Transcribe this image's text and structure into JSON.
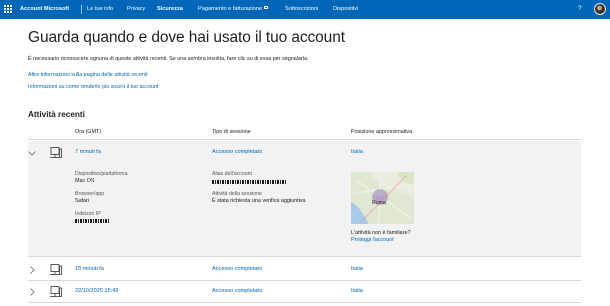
{
  "topbar": {
    "brand": "Account Microsoft",
    "nav": [
      "Le tue info",
      "Privacy",
      "Sicurezza",
      "Pagamento e fatturazione",
      "Sottoscrizioni",
      "Dispositivi"
    ],
    "active": "Sicurezza",
    "help": "?",
    "background": "#0067b8"
  },
  "page": {
    "title": "Guarda quando e dove hai usato il tuo account",
    "intro": "È necessario riconoscere ognuna di queste attività recenti. Se una sembra insolita, fare clic su di essa per segnalarla.",
    "links": [
      "Altre informazioni sulla pagina delle attività recenti",
      "Informazioni su come renderlo più sicuro il tuo account"
    ],
    "section_title": "Attività recenti",
    "link_color": "#0067b8"
  },
  "table": {
    "headers": {
      "time": "Ora (GMT)",
      "session": "Tipo di sessione",
      "location": "Posizione approssimativa"
    },
    "rows": [
      {
        "time": "7 minuti fa",
        "session": "Accesso completato",
        "location": "Italia",
        "expanded": true
      },
      {
        "time": "15 minuti fa",
        "session": "Accesso completato",
        "location": "Italia",
        "expanded": false
      },
      {
        "time": "22/10/2025 15:49",
        "session": "Accesso completato",
        "location": "Italia",
        "expanded": false
      }
    ]
  },
  "details": {
    "platform_label": "Dispositivo/piattaforma",
    "platform_value": "Mac OS",
    "browser_label": "Browser/app",
    "browser_value": "Safari",
    "ip_label": "Indirizzo IP",
    "alias_label": "Alias dell'account",
    "activity_label": "Attività della sessione",
    "activity_value": "È stata richiesta una verifica aggiuntiva",
    "map_city": "Roma",
    "unfamiliar": "L'attività non è familiare?",
    "protect": "Proteggi l'account"
  }
}
